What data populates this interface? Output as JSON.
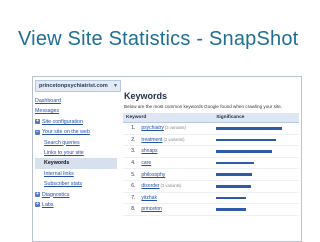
{
  "slide_title": "View Site Statistics - SnapShot",
  "site_selector": {
    "value": "princetonpsychiatrist.com"
  },
  "sidebar": {
    "items": [
      {
        "label": "Dashboard",
        "kind": "nb"
      },
      {
        "label": "Messages",
        "kind": "nb"
      },
      {
        "label": "Site configuration",
        "kind": "top",
        "toggle": "+"
      },
      {
        "label": "Your site on the web",
        "kind": "top",
        "toggle": "−"
      },
      {
        "label": "Search queries",
        "kind": "sub"
      },
      {
        "label": "Links to your site",
        "kind": "sub"
      },
      {
        "label": "Keywords",
        "kind": "sub",
        "active": true
      },
      {
        "label": "Internal links",
        "kind": "sub"
      },
      {
        "label": "Subscriber stats",
        "kind": "sub"
      },
      {
        "label": "Diagnostics",
        "kind": "top",
        "toggle": "+"
      },
      {
        "label": "Labs",
        "kind": "top",
        "toggle": "+"
      }
    ]
  },
  "main": {
    "title": "Keywords",
    "description": "Below are the most common keywords Google found when crawling your site.",
    "columns": {
      "keyword": "Keyword",
      "significance": "Significance"
    },
    "rows": [
      {
        "rank": "1.",
        "term": "psychiatry",
        "variants": "(3 variants)",
        "significance": 0.92
      },
      {
        "rank": "2.",
        "term": "treatment",
        "variants": "(2 variants)",
        "significance": 0.83
      },
      {
        "rank": "3.",
        "term": "shnaps",
        "variants": "",
        "significance": 0.78
      },
      {
        "rank": "4.",
        "term": "care",
        "variants": "",
        "significance": 0.52
      },
      {
        "rank": "5.",
        "term": "philosophy",
        "variants": "",
        "significance": 0.5
      },
      {
        "rank": "6.",
        "term": "disorder",
        "variants": "(3 variants)",
        "significance": 0.48
      },
      {
        "rank": "7.",
        "term": "yitzhak",
        "variants": "",
        "significance": 0.42
      },
      {
        "rank": "8.",
        "term": "princeton",
        "variants": "",
        "significance": 0.42
      }
    ]
  },
  "colors": {
    "accent": "#1f6e93",
    "bar": "#2d5ba8",
    "link": "#2351a8"
  }
}
